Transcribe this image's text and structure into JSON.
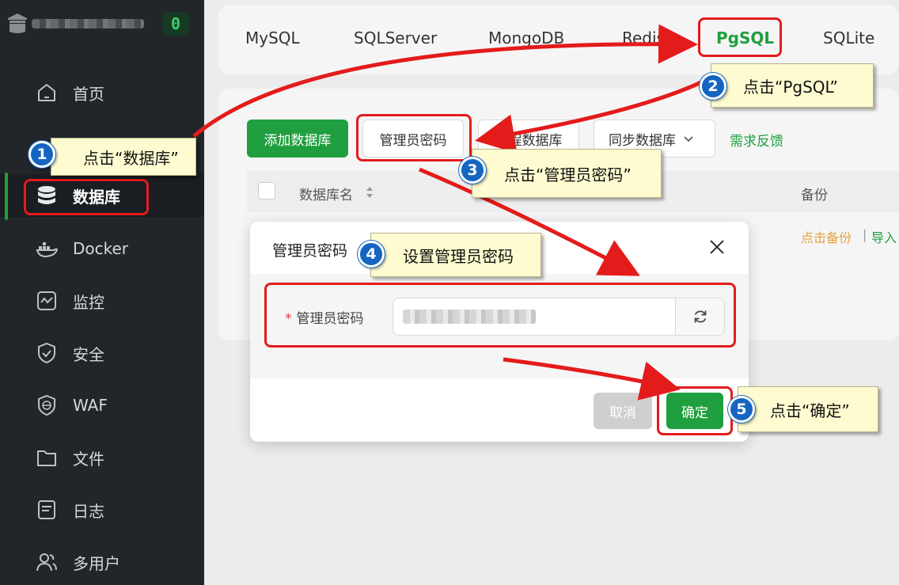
{
  "sidebar": {
    "badge": "0",
    "items": [
      {
        "label": "首页",
        "icon": "home-icon"
      },
      {
        "label": "数据库",
        "icon": "database-icon",
        "active": true
      },
      {
        "label": "Docker",
        "icon": "docker-icon"
      },
      {
        "label": "监控",
        "icon": "monitor-icon"
      },
      {
        "label": "安全",
        "icon": "shield-check-icon"
      },
      {
        "label": "WAF",
        "icon": "globe-shield-icon"
      },
      {
        "label": "文件",
        "icon": "folder-icon"
      },
      {
        "label": "日志",
        "icon": "log-icon"
      },
      {
        "label": "多用户",
        "icon": "users-icon"
      }
    ]
  },
  "tabs": [
    "MySQL",
    "SQLServer",
    "MongoDB",
    "Redis",
    "PgSQL",
    "SQLite"
  ],
  "toolbar": {
    "add_db": "添加数据库",
    "admin_password": "管理员密码",
    "remote_db": "远程数据库",
    "sync_db": "同步数据库",
    "feedback": "需求反馈"
  },
  "table": {
    "col_name": "数据库名",
    "col_backup": "备份",
    "row_actions": [
      "点击备份",
      "导入"
    ]
  },
  "dialog": {
    "title": "管理员密码",
    "field_label": "管理员密码",
    "required_mark": "*",
    "cancel": "取消",
    "confirm": "确定"
  },
  "annotations": [
    {
      "num": "1",
      "text": "点击“数据库”"
    },
    {
      "num": "2",
      "text": "点击“PgSQL”"
    },
    {
      "num": "3",
      "text": "点击“管理员密码”"
    },
    {
      "num": "4",
      "text": "设置管理员密码"
    },
    {
      "num": "5",
      "text": "点击“确定”"
    }
  ],
  "colors": {
    "accent": "#1f9f3f",
    "sidebar": "#22262b",
    "annotation_red": "#e41b1b",
    "callout": "#fffbd0",
    "step_blue": "#1565c0"
  }
}
